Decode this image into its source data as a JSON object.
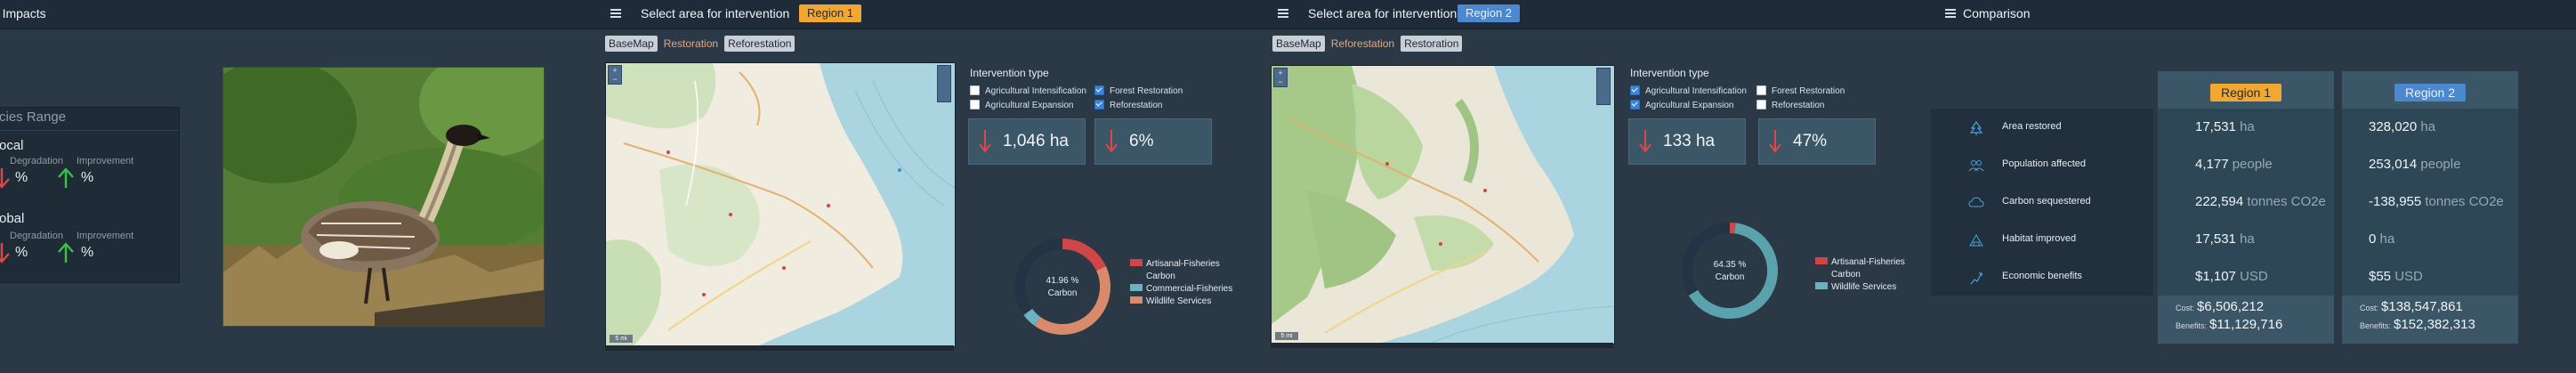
{
  "panel1": {
    "title": "nal Impacts",
    "species_range_title": "cies Range",
    "local": {
      "label": "ocal",
      "degradation_label": "Degradation",
      "improvement_label": "Improvement",
      "degradation_pct": "%",
      "improvement_pct": "%"
    },
    "global": {
      "label": "obal",
      "degradation_label": "Degradation",
      "improvement_label": "Improvement",
      "degradation_pct": "%",
      "improvement_pct": "%"
    },
    "image_subject": "nene-goose-photo"
  },
  "panel2": {
    "title": "Select area for intervention",
    "region_badge": "Region 1",
    "tabs": [
      "BaseMap",
      "Restoration",
      "Reforestation"
    ],
    "map_scale": "5 mi",
    "intervention_title": "Intervention type",
    "checkboxes": [
      {
        "label": "Agricultural Intensification",
        "checked": false
      },
      {
        "label": "Agricultural Expansion",
        "checked": false
      },
      {
        "label": "Forest Restoration",
        "checked": true
      },
      {
        "label": "Reforestation",
        "checked": true
      }
    ],
    "metric1": "1,046 ha",
    "metric2": "6%",
    "donut": {
      "center_pct": "41.96 %",
      "center_label": "Carbon",
      "slices": [
        {
          "name": "Artisanal-Fisheries",
          "value": 18,
          "color": "#d04545"
        },
        {
          "name": "Carbon",
          "value": 41.96,
          "color": "#d98a6b"
        },
        {
          "name": "Commercial-Fisheries",
          "value": 5,
          "color": "#6ab2c0"
        },
        {
          "name": "Wildlife Services",
          "value": 35.04,
          "color": "#243444"
        }
      ],
      "legend": [
        {
          "label": "Artisanal-Fisheries",
          "color": "#d04545"
        },
        {
          "label": "Carbon",
          "color": "#2b3947"
        },
        {
          "label": "Commercial-Fisheries",
          "color": "#6ab2c0"
        },
        {
          "label": "Wildlife Services",
          "color": "#d98a6b"
        }
      ]
    }
  },
  "panel3": {
    "title": "Select area for intervention",
    "region_badge": "Region 2",
    "tabs": [
      "BaseMap",
      "Reforestation",
      "Restoration"
    ],
    "map_scale": "5 mi",
    "intervention_title": "Intervention type",
    "checkboxes": [
      {
        "label": "Agricultural Intensification",
        "checked": true
      },
      {
        "label": "Agricultural Expansion",
        "checked": true
      },
      {
        "label": "Forest Restoration",
        "checked": false
      },
      {
        "label": "Reforestation",
        "checked": false
      }
    ],
    "metric1": "133 ha",
    "metric2": "47%",
    "donut": {
      "center_pct": "64.35 %",
      "center_label": "Carbon",
      "slices": [
        {
          "name": "Artisanal-Fisheries",
          "value": 2,
          "color": "#d04545"
        },
        {
          "name": "Carbon",
          "value": 64.35,
          "color": "#5aa3ad"
        },
        {
          "name": "Wildlife Services",
          "value": 33.65,
          "color": "#243444"
        }
      ],
      "legend": [
        {
          "label": "Artisanal-Fisheries",
          "color": "#d04545"
        },
        {
          "label": "Carbon",
          "color": "#2b3947"
        },
        {
          "label": "Wildlife Services",
          "color": "#6ab2c0"
        }
      ]
    }
  },
  "panel4": {
    "title": "Comparison",
    "rows": [
      "Area restored",
      "Population affected",
      "Carbon sequestered",
      "Habitat improved",
      "Economic benefits"
    ],
    "row_icons": [
      "tree-icon",
      "people-icon",
      "cloud-icon",
      "habitat-icon",
      "economic-icon"
    ],
    "region1": {
      "badge": "Region 1",
      "values": [
        {
          "num": "17,531",
          "unit": "ha"
        },
        {
          "num": "4,177",
          "unit": "people"
        },
        {
          "num": "222,594",
          "unit": "tonnes CO2e"
        },
        {
          "num": "17,531",
          "unit": "ha"
        },
        {
          "num": "$1,107",
          "unit": "USD"
        }
      ],
      "cost_label": "Cost:",
      "cost": "$6,506,212",
      "benefits_label": "Benefits:",
      "benefits": "$11,129,716"
    },
    "region2": {
      "badge": "Region 2",
      "values": [
        {
          "num": "328,020",
          "unit": "ha"
        },
        {
          "num": "253,014",
          "unit": "people"
        },
        {
          "num": "-138,955",
          "unit": "tonnes CO2e"
        },
        {
          "num": "0",
          "unit": "ha"
        },
        {
          "num": "$55",
          "unit": "USD"
        }
      ],
      "cost_label": "Cost:",
      "cost": "$138,547,861",
      "benefits_label": "Benefits:",
      "benefits": "$152,382,313"
    }
  },
  "colors": {
    "orange_badge": "#f2a730",
    "blue_badge": "#4a88cf",
    "arrow_down": "#e04848",
    "arrow_up": "#37c24a",
    "card": "#3b5667"
  }
}
